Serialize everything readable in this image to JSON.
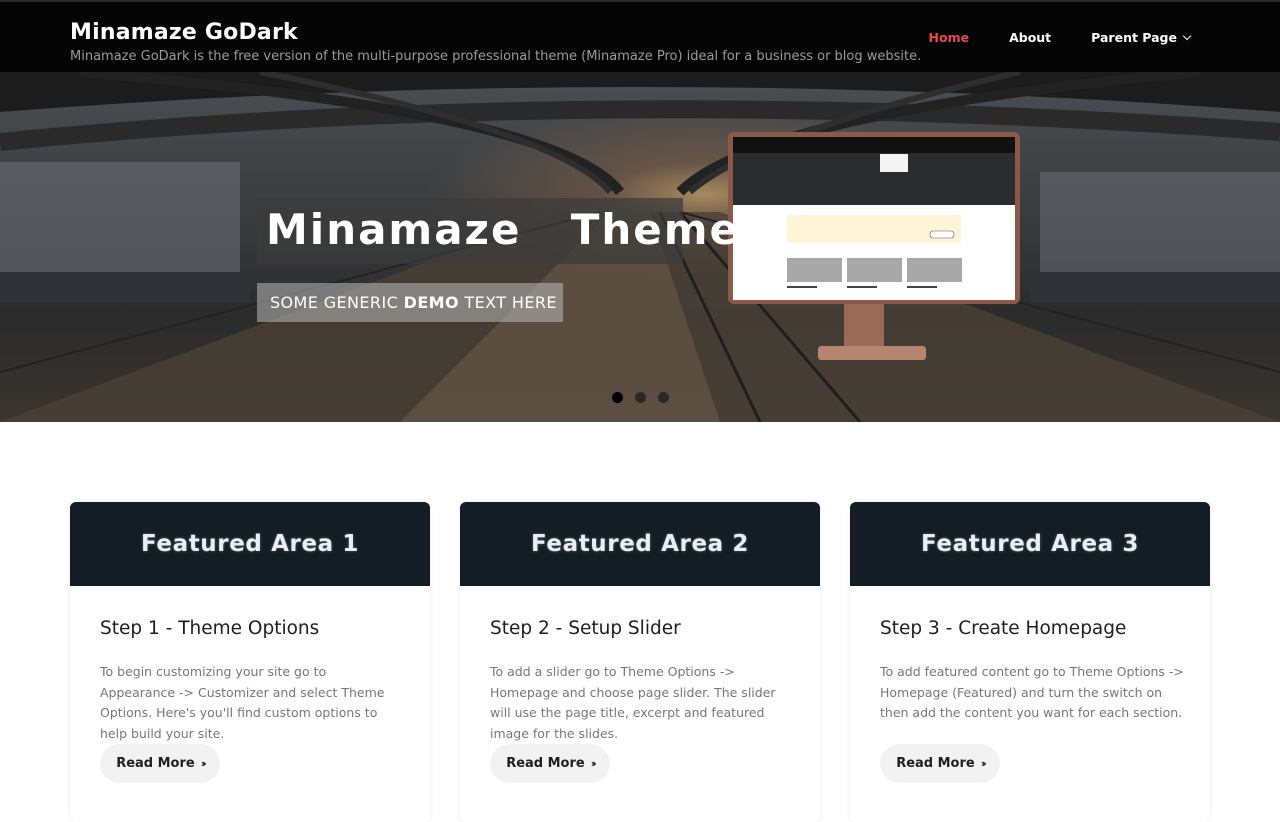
{
  "header": {
    "site_title": "Minamaze GoDark",
    "site_description": "Minamaze GoDark is the free version of the multi-purpose professional theme (Minamaze Pro) ideal for a business or blog website.",
    "nav": [
      {
        "label": "Home",
        "active": true
      },
      {
        "label": "About",
        "active": false
      },
      {
        "label": "Parent Page",
        "active": false,
        "dropdown": true
      }
    ],
    "active_color": "#e84a4a"
  },
  "slider": {
    "title": "Minamaze  Theme",
    "subtitle_pre": "SOME GENERIC ",
    "subtitle_bold": "DEMO",
    "subtitle_post": " TEXT HERE",
    "slide_count": 3,
    "active_slide": 1
  },
  "featured": [
    {
      "header": "Featured Area 1",
      "title": "Step 1 - Theme Options",
      "text": "To begin customizing your site go to Appearance -> Customizer and select Theme Options. Here's you'll find custom options to help build your site.",
      "button": "Read More"
    },
    {
      "header": "Featured Area 2",
      "title": "Step 2 - Setup Slider",
      "text": "To add a slider go to Theme Options -> Homepage and choose page slider. The slider will use the page title, excerpt and featured image for the slides.",
      "button": "Read More"
    },
    {
      "header": "Featured Area 3",
      "title": "Step 3 - Create Homepage",
      "text": "To add featured content go to Theme Options -> Homepage (Featured) and turn the switch on then add the content you want for each section.",
      "button": "Read More"
    }
  ],
  "icons": {
    "dropdown": "chevron-down-icon",
    "read_more": "double-chevron-right-icon"
  }
}
